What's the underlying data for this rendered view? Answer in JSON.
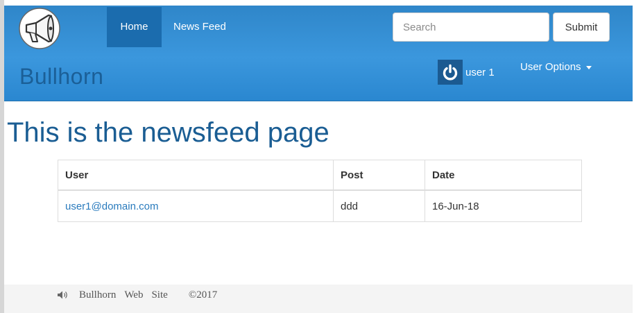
{
  "navbar": {
    "home_label": "Home",
    "newsfeed_label": "News Feed",
    "brand": "Bullhorn",
    "search_placeholder": "Search",
    "submit_label": "Submit",
    "user_label": "user 1",
    "user_options_label": "User Options",
    "logo_icon": "megaphone-icon",
    "colors": {
      "bar": "#3b97dd",
      "active": "#1b6cae",
      "brand_text": "#1b5f97"
    }
  },
  "main": {
    "title": "This is the newsfeed page",
    "table": {
      "headers": [
        "User",
        "Post",
        "Date"
      ],
      "rows": [
        {
          "user": "user1@domain.com",
          "post": "ddd",
          "date": "16-Jun-18"
        }
      ]
    }
  },
  "footer": {
    "icon": "speaker-icon",
    "words": [
      "Bullhorn",
      "Web",
      "Site"
    ],
    "copyright": "©2017"
  }
}
